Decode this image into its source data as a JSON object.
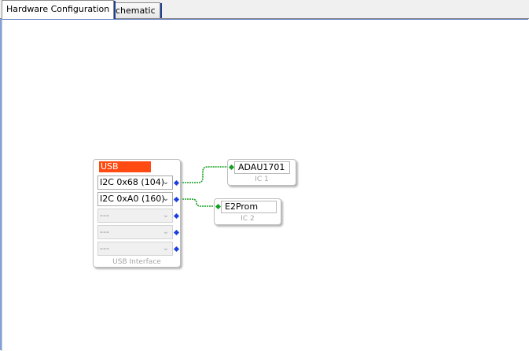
{
  "tabs": [
    {
      "label": "Hardware Configuration",
      "active": true
    },
    {
      "label": "Schematic",
      "active": false
    }
  ],
  "usb_block": {
    "title": "USB",
    "caption": "USB Interface",
    "ports": [
      {
        "value": "I2C 0x68 (104)",
        "enabled": true
      },
      {
        "value": "I2C 0xA0 (160)",
        "enabled": true
      },
      {
        "value": "---",
        "enabled": false
      },
      {
        "value": "---",
        "enabled": false
      },
      {
        "value": "---",
        "enabled": false
      }
    ]
  },
  "ic_blocks": [
    {
      "name": "ADAU1701",
      "caption": "IC 1"
    },
    {
      "name": "E2Prom",
      "caption": "IC 2"
    }
  ],
  "colors": {
    "usb_title": "#ff4a12",
    "wire": "#14a020",
    "pin_blue": "#1a3ee0",
    "pin_green": "#14a020",
    "tab_accent": "#1f3f8f"
  },
  "icons": {
    "dropdown": "chevron-down-icon",
    "port": "diamond-pin-icon"
  }
}
